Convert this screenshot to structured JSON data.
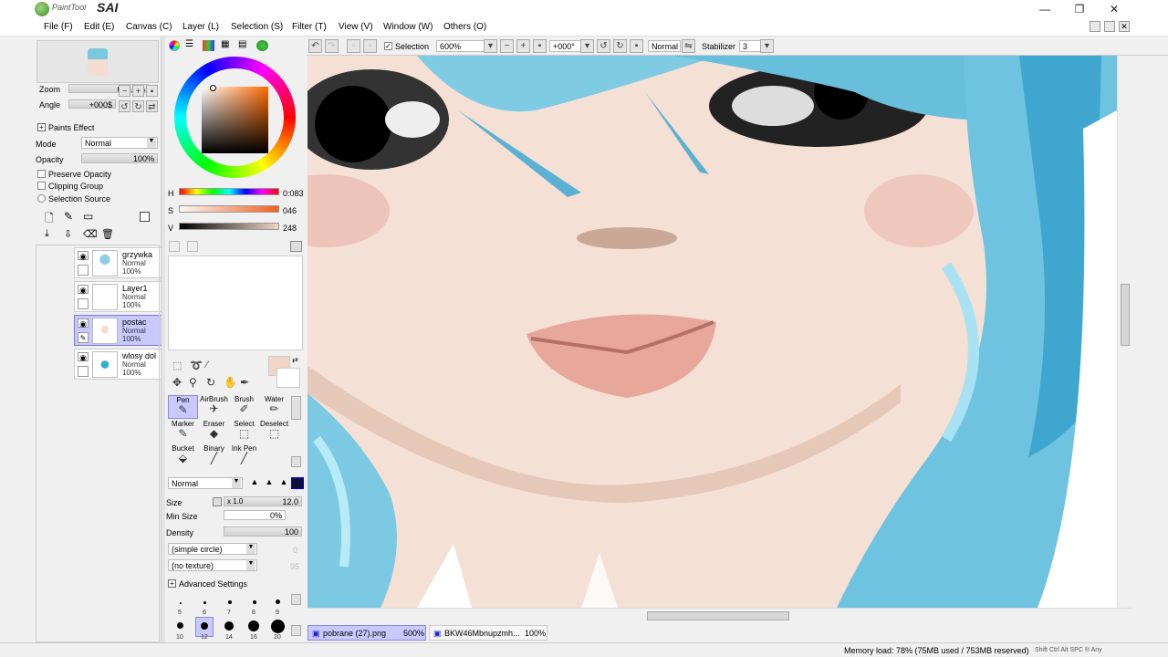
{
  "app": {
    "brand_small": "PaintTool",
    "brand_big": "SAI"
  },
  "window_controls": {
    "minimize": "—",
    "restore": "❐",
    "close": "✕"
  },
  "menu": [
    "File (F)",
    "Edit (E)",
    "Canvas (C)",
    "Layer (L)",
    "Selection (S)",
    "Filter (T)",
    "View (V)",
    "Window (W)",
    "Others (O)"
  ],
  "navigator": {
    "zoom_label": "Zoom",
    "zoom_value": "600.0%",
    "angle_label": "Angle",
    "angle_value": "+000$"
  },
  "paint_effect": {
    "title": "Paints Effect",
    "mode_label": "Mode",
    "mode_value": "Normal",
    "opacity_label": "Opacity",
    "opacity_value": "100%",
    "preserve_opacity": "Preserve Opacity",
    "clipping_group": "Clipping Group",
    "selection_source": "Selection Source"
  },
  "layers": [
    {
      "name": "grzywka",
      "mode": "Normal",
      "opacity": "100%",
      "selected": false
    },
    {
      "name": "Layer1",
      "mode": "Normal",
      "opacity": "100%",
      "selected": false
    },
    {
      "name": "postac",
      "mode": "Normal",
      "opacity": "100%",
      "selected": true
    },
    {
      "name": "wlosy dol",
      "mode": "Normal",
      "opacity": "100%",
      "selected": false
    }
  ],
  "color": {
    "h_label": "H",
    "h_value": "0:083",
    "s_label": "S",
    "s_value": "046",
    "v_label": "V",
    "v_value": "248",
    "current": "#f1d5c6"
  },
  "tools": [
    {
      "name": "Pen",
      "selected": true
    },
    {
      "name": "AirBrush"
    },
    {
      "name": "Brush"
    },
    {
      "name": "Water"
    },
    {
      "name": "Marker"
    },
    {
      "name": "Eraser"
    },
    {
      "name": "Select"
    },
    {
      "name": "Deselect"
    },
    {
      "name": "Bucket"
    },
    {
      "name": "Binary"
    },
    {
      "name": "Ink Pen"
    }
  ],
  "brush": {
    "blend_mode": "Normal",
    "size_label": "Size",
    "size_multiplier": "x 1.0",
    "size_value": "12.0",
    "min_size_label": "Min Size",
    "min_size_value": "0%",
    "density_label": "Density",
    "density_value": "100",
    "shape": "(simple circle)",
    "shape_value": "0",
    "texture": "(no texture)",
    "texture_value": "95",
    "advanced": "Advanced Settings",
    "sizes_row1": [
      "5",
      "6",
      "7",
      "8",
      "9"
    ],
    "sizes_row2": [
      "10",
      "12",
      "14",
      "16",
      "20"
    ]
  },
  "toolbar": {
    "selection_label": "Selection",
    "zoom": "600%",
    "angle": "+000°",
    "blend": "Normal",
    "stabilizer_label": "Stabilizer",
    "stabilizer_value": "3"
  },
  "documents": [
    {
      "name": "pobrane (27).png",
      "zoom": "500%"
    },
    {
      "name": "BKW46Mbnupzmh...",
      "zoom": "100%"
    }
  ],
  "status": {
    "memory": "Memory load: 78% (75MB used / 753MB reserved)",
    "keys": "Shift Ctrl Alt SPC ® Any"
  },
  "colors": {
    "accent_selection": "#c9c9ff",
    "hair": "#6cc3e0",
    "skin": "#f4e0d4",
    "lips": "#e9a99b"
  }
}
